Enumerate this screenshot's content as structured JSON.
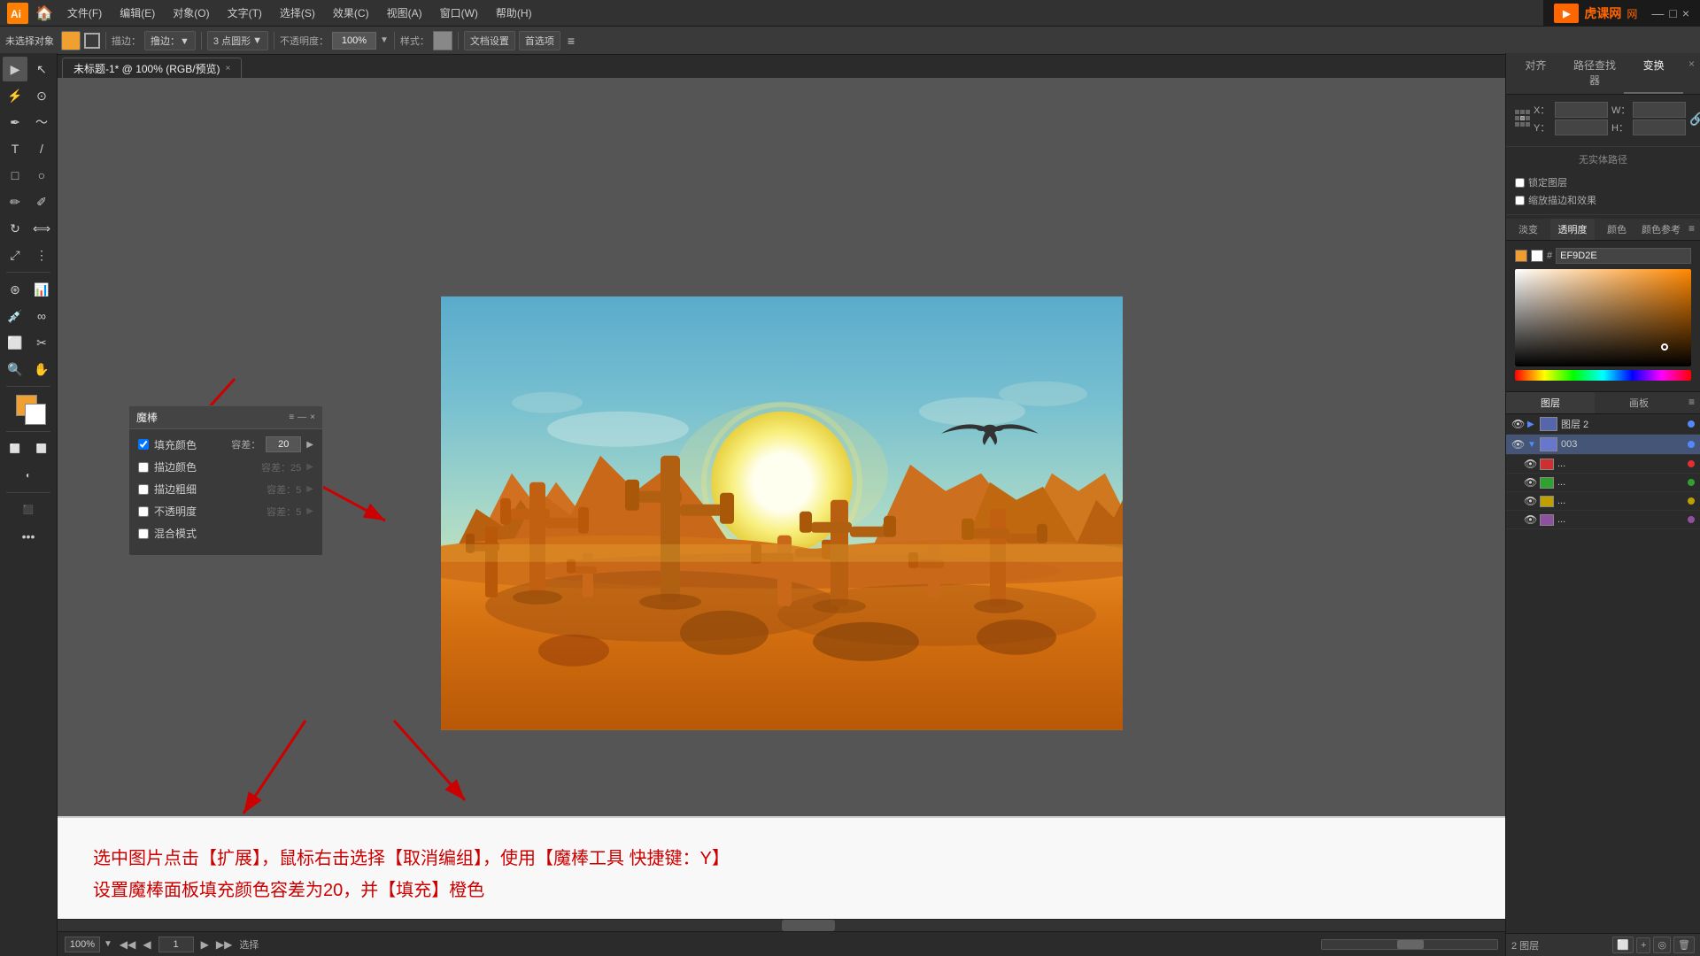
{
  "app": {
    "title": "Adobe Illustrator",
    "brand": "虎课网",
    "brand_icon": "▶"
  },
  "menubar": {
    "items": [
      {
        "label": "文件(F)"
      },
      {
        "label": "编辑(E)"
      },
      {
        "label": "对象(O)"
      },
      {
        "label": "文字(T)"
      },
      {
        "label": "选择(S)"
      },
      {
        "label": "效果(C)"
      },
      {
        "label": "视图(A)"
      },
      {
        "label": "窗口(W)"
      },
      {
        "label": "帮助(H)"
      }
    ]
  },
  "toolbar": {
    "selection_label": "未选择对象",
    "stroke_label": "描边：",
    "spray_label": "撸边：",
    "points_label": "3 点圆形",
    "opacity_label": "不透明度：",
    "opacity_value": "100%",
    "style_label": "样式：",
    "doc_settings": "文档设置",
    "preferences": "首选项"
  },
  "tab": {
    "title": "未标题-1* @ 100% (RGB/预览)",
    "close": "×"
  },
  "magic_panel": {
    "title": "魔棒",
    "fill_color_label": "填充颜色",
    "fill_color_checked": true,
    "tolerance_label": "容差：",
    "tolerance_value": "20",
    "stroke_color_label": "描边颜色",
    "stroke_color_checked": false,
    "stroke_tolerance_label": "容差：",
    "stroke_tolerance_value": "25",
    "stroke_width_label": "描边粗细",
    "stroke_width_checked": false,
    "stroke_width_tolerance_label": "容差：",
    "stroke_width_tolerance_value": "5",
    "opacity_label": "不透明度",
    "opacity_checked": false,
    "opacity_tolerance_label": "容差：",
    "opacity_tolerance_value": "5",
    "blend_label": "混合模式",
    "blend_checked": false,
    "min_btn": "—",
    "close_btn": "×"
  },
  "right_panel": {
    "tabs": [
      "对齐",
      "路径查找器",
      "变换"
    ],
    "active_tab": "变换",
    "x_label": "X：",
    "y_label": "Y：",
    "w_label": "W：",
    "h_label": "H：",
    "x_value": "",
    "y_value": "",
    "w_value": "",
    "h_value": "",
    "status_text": "无实体路径",
    "constrain_label": "锁定图层",
    "apply_effects_label": "缩放描边和效果"
  },
  "color_panel": {
    "hex_value": "EF9D2E",
    "hue_label": "颜色",
    "saturation_label": "淡变",
    "opacity_label": "透明度",
    "color_ref_label": "颜色参考"
  },
  "layers_panel": {
    "tabs": [
      "图层",
      "画板"
    ],
    "active_tab": "图层",
    "layers": [
      {
        "name": "图层 2",
        "expanded": true,
        "visible": true,
        "selected": false,
        "color": "blue"
      },
      {
        "name": "003",
        "expanded": false,
        "visible": true,
        "selected": true,
        "color": "blue"
      },
      {
        "name": "...",
        "visible": true,
        "dot_color": "red"
      },
      {
        "name": "...",
        "visible": true,
        "dot_color": "green"
      },
      {
        "name": "...",
        "visible": true,
        "dot_color": "yellow"
      },
      {
        "name": "...",
        "visible": true,
        "dot_color": "purple"
      }
    ],
    "bottom_label": "2 图层",
    "new_layer_btn": "＋",
    "delete_btn": "🗑"
  },
  "statusbar": {
    "zoom": "100%",
    "page_num": "1",
    "selection_label": "选择"
  },
  "annotation": {
    "line1": "选中图片点击【扩展】，鼠标右击选择【取消编组】，使用【魔棒工具 快捷键：Y】",
    "line2": "设置魔棒面板填充颜色容差为20，并【填充】橙色"
  },
  "canvas": {
    "zoom": "100%"
  }
}
